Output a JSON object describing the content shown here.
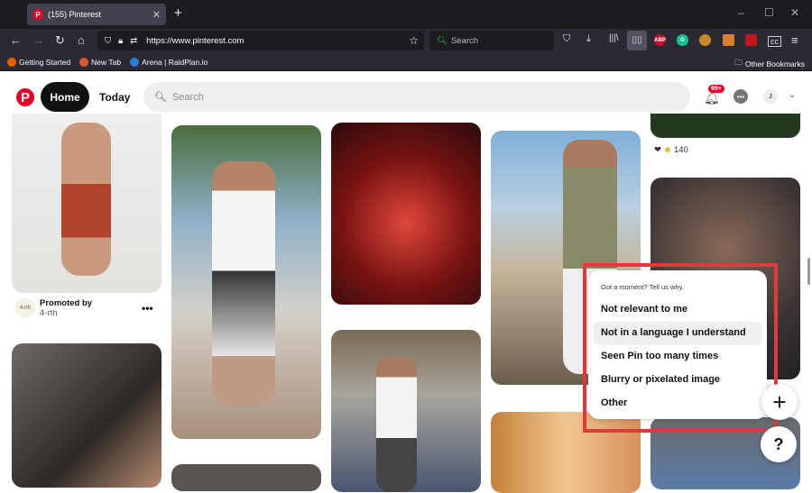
{
  "browser": {
    "tab_title": "(155) Pinterest",
    "url": "https://www.pinterest.com",
    "search_placeholder": "Search",
    "bookmarks": [
      "Getting Started",
      "New Tab",
      "Arena | RaidPlan.io"
    ],
    "other_bookmarks": "Other Bookmarks",
    "extensions": [
      {
        "name": "adblock-plus",
        "label": "ABP",
        "color": "#c70d2c"
      },
      {
        "name": "grammarly",
        "label": "G",
        "color": "#15c39a"
      },
      {
        "name": "monkey",
        "label": "",
        "color": "#c98a2c"
      },
      {
        "name": "extension-orange",
        "label": "",
        "color": "#d9822b"
      },
      {
        "name": "extension-red",
        "label": "",
        "color": "#c4161c"
      }
    ]
  },
  "header": {
    "home": "Home",
    "today": "Today",
    "search_placeholder": "Search",
    "notification_badge": "99+",
    "avatar_initial": "J"
  },
  "feed": {
    "promoted_by": "Promoted by",
    "advertiser": "4-rth",
    "advertiser_logo": "4-rth",
    "reaction_count": "140"
  },
  "feedback_menu": {
    "title": "Got a moment? Tell us why.",
    "options": [
      "Not relevant to me",
      "Not in a language I understand",
      "Seen Pin too many times",
      "Blurry or pixelated image",
      "Other"
    ],
    "highlighted_index": 1
  },
  "colors": {
    "accent": "#e60023",
    "highlight_box": "#e03a3a"
  }
}
